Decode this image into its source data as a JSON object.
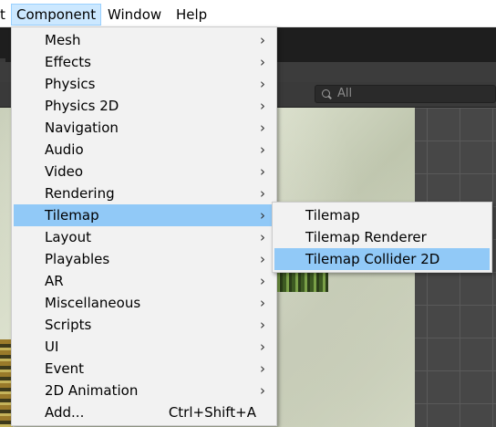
{
  "menubar": {
    "items": [
      {
        "label": "t"
      },
      {
        "label": "Component"
      },
      {
        "label": "Window"
      },
      {
        "label": "Help"
      }
    ]
  },
  "editor": {
    "search_placeholder": "All"
  },
  "component_menu": {
    "items": [
      {
        "label": "Mesh",
        "submenu": true
      },
      {
        "label": "Effects",
        "submenu": true
      },
      {
        "label": "Physics",
        "submenu": true
      },
      {
        "label": "Physics 2D",
        "submenu": true
      },
      {
        "label": "Navigation",
        "submenu": true
      },
      {
        "label": "Audio",
        "submenu": true
      },
      {
        "label": "Video",
        "submenu": true
      },
      {
        "label": "Rendering",
        "submenu": true
      },
      {
        "label": "Tilemap",
        "submenu": true,
        "highlighted": true
      },
      {
        "label": "Layout",
        "submenu": true
      },
      {
        "label": "Playables",
        "submenu": true
      },
      {
        "label": "AR",
        "submenu": true
      },
      {
        "label": "Miscellaneous",
        "submenu": true
      },
      {
        "label": "Scripts",
        "submenu": true
      },
      {
        "label": "UI",
        "submenu": true
      },
      {
        "label": "Event",
        "submenu": true
      },
      {
        "label": "2D Animation",
        "submenu": true
      },
      {
        "label": "Add...",
        "shortcut": "Ctrl+Shift+A"
      }
    ]
  },
  "tilemap_submenu": {
    "items": [
      {
        "label": "Tilemap"
      },
      {
        "label": "Tilemap Renderer"
      },
      {
        "label": "Tilemap Collider 2D",
        "highlighted": true
      }
    ]
  },
  "icons": {
    "submenu_arrow": "chevron-right-icon",
    "search": "search-icon"
  },
  "colors": {
    "menu_background": "#f2f2f2",
    "highlight": "#91c9f7",
    "menubar_active": "#cce8ff",
    "editor_dark": "#2b2b2b"
  }
}
